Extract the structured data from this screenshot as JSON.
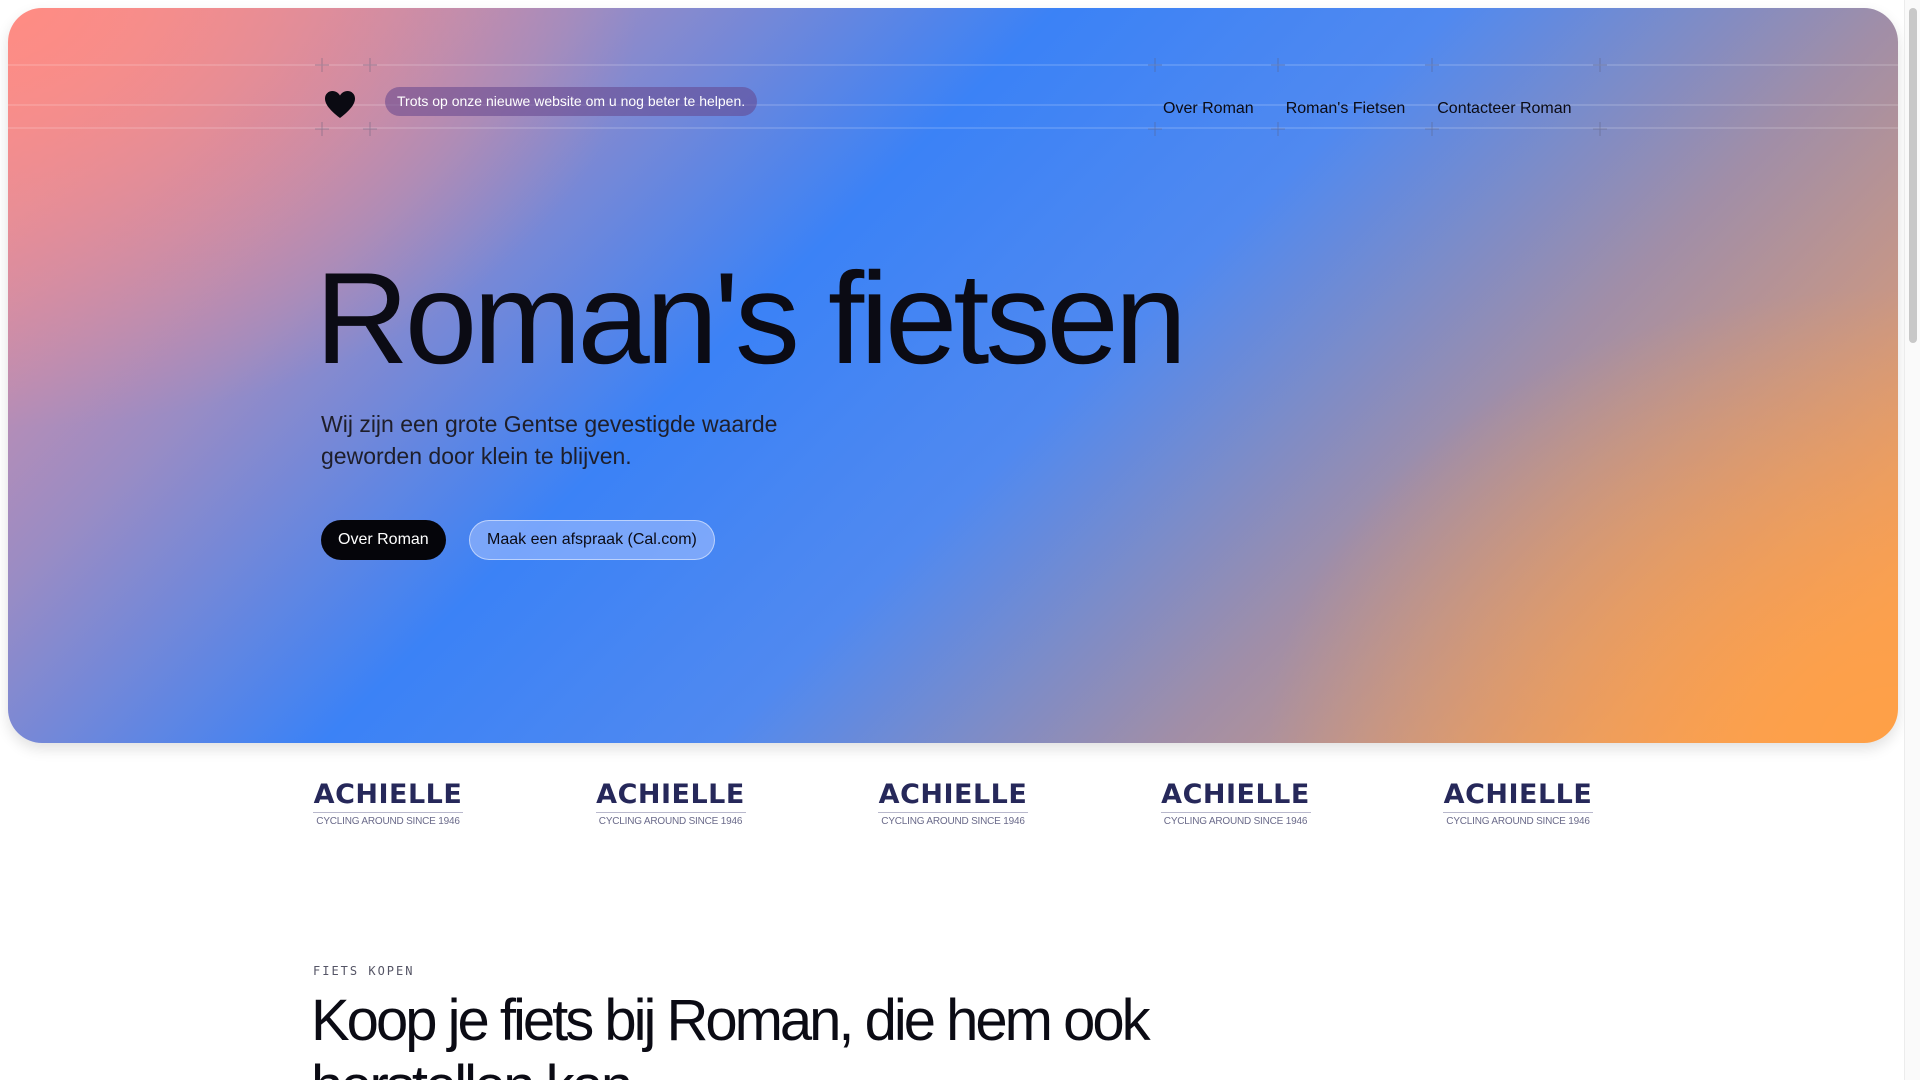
{
  "header": {
    "logo_icon": "heart-icon",
    "announcement": "Trots op onze nieuwe website om u nog beter te helpen.",
    "nav": [
      "Over Roman",
      "Roman's Fietsen",
      "Contacteer Roman"
    ]
  },
  "hero": {
    "title": "Roman's fietsen",
    "subtitle": "Wij zijn een grote Gentse gevestigde waarde geworden door klein te blijven.",
    "primary_button": "Over Roman",
    "secondary_button": "Maak een afspraak (Cal.com)"
  },
  "brands": [
    {
      "name": "ACHIELLE",
      "tagline": "CYCLING AROUND SINCE 1946"
    },
    {
      "name": "ACHIELLE",
      "tagline": "CYCLING AROUND SINCE 1946"
    },
    {
      "name": "ACHIELLE",
      "tagline": "CYCLING AROUND SINCE 1946"
    },
    {
      "name": "ACHIELLE",
      "tagline": "CYCLING AROUND SINCE 1946"
    },
    {
      "name": "ACHIELLE",
      "tagline": "CYCLING AROUND SINCE 1946"
    }
  ],
  "section": {
    "eyebrow": "FIETS KOPEN",
    "title": "Koop je fiets bij Roman, die hem ook herstellen kan."
  },
  "colors": {
    "gradient_pink": "#f49098",
    "gradient_blue": "#3b82f6",
    "gradient_orange": "#f3a060",
    "text_dark": "#0b0b14",
    "brand_navy": "#26285a"
  }
}
